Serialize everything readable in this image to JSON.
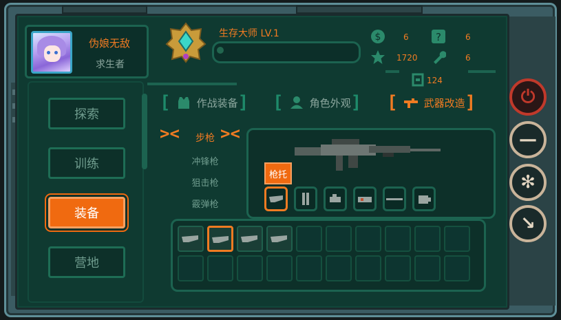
{
  "profile": {
    "nickname": "伪娘无敌",
    "role": "求生者"
  },
  "rank": {
    "title": "生存大师 LV.1",
    "xp_fraction": 0.05
  },
  "stats": {
    "coins": "6",
    "stars": "1720",
    "quests": "6",
    "tools": "6",
    "storage": "124"
  },
  "menu": {
    "items": [
      "探索",
      "训练",
      "装备",
      "营地"
    ],
    "active": "装备"
  },
  "tabs": {
    "combat_gear": "作战装备",
    "appearance": "角色外观",
    "weapon_mod": "武器改造"
  },
  "weapon_categories": {
    "rifle": "步枪",
    "smg": "冲锋枪",
    "sniper": "狙击枪",
    "shotgun": "霰弹枪"
  },
  "weapon": {
    "selected_part": "枪托"
  },
  "part_slots": [
    "stock",
    "magazine",
    "grip",
    "scope",
    "barrel",
    "muzzle"
  ],
  "inventory_items": 4,
  "colors": {
    "accent": "#f07b22",
    "panel": "#0f3a31",
    "frame": "#3b5c63",
    "border": "#1c6350"
  },
  "right_buttons": [
    "power-icon",
    "minus-icon",
    "gear-icon",
    "arrow-down-right-icon"
  ]
}
